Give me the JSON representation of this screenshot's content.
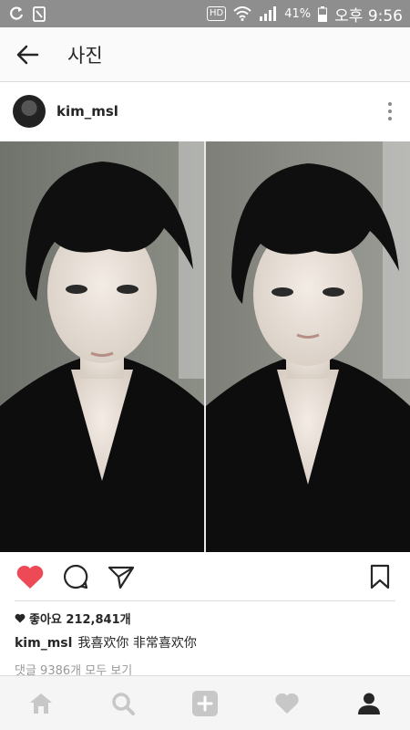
{
  "status_bar": {
    "icons_left": [
      "sync-icon",
      "sim-icon"
    ],
    "hd": "HD",
    "battery": "41%",
    "time": "오후 9:56"
  },
  "appbar": {
    "title": "사진"
  },
  "post": {
    "username": "kim_msl",
    "likes": "좋아요 212,841개",
    "caption_user": "kim_msl",
    "caption_text": "我喜欢你 非常喜欢你",
    "comments": "댓글 9386개 모두 보기"
  },
  "colors": {
    "like": "#ed4956",
    "status_bar": "#8e8e8e"
  },
  "nav": [
    "home-icon",
    "search-icon",
    "add-icon",
    "activity-icon",
    "profile-icon"
  ]
}
